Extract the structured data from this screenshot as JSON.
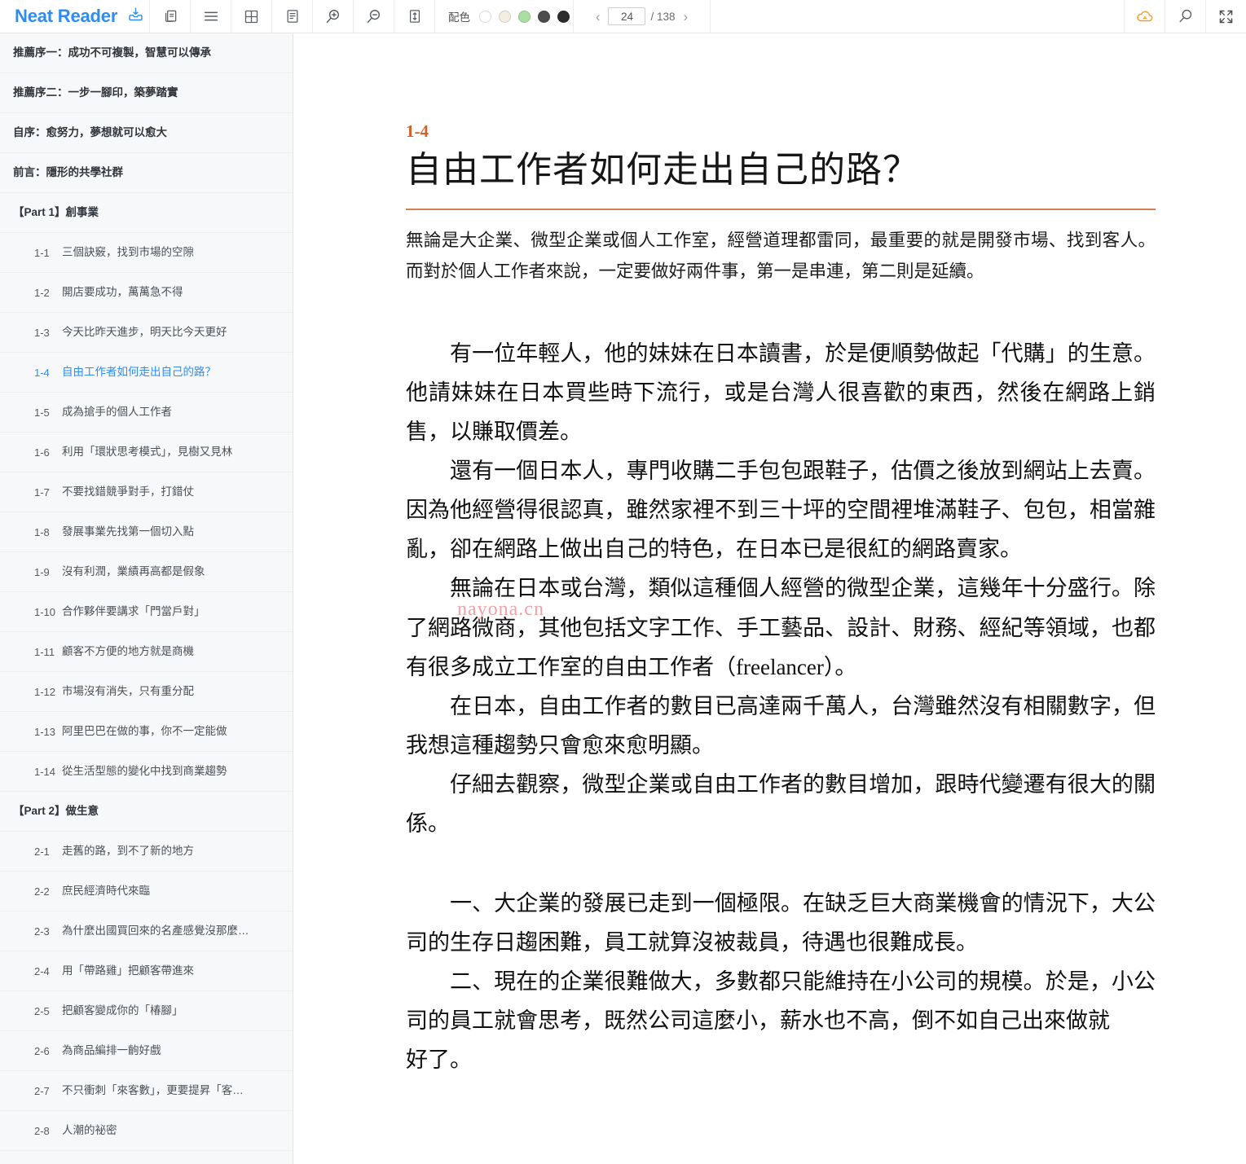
{
  "toolbar": {
    "brand": "Neat Reader",
    "icons": [
      {
        "name": "import-icon",
        "label": "Import"
      },
      {
        "name": "bookshelf-icon",
        "label": "Bookshelf"
      },
      {
        "name": "contents-icon",
        "label": "Contents"
      },
      {
        "name": "grid-view-icon",
        "label": "Grid view"
      },
      {
        "name": "notes-icon",
        "label": "Notes"
      },
      {
        "name": "zoom-in-icon",
        "label": "Zoom in"
      },
      {
        "name": "zoom-out-icon",
        "label": "Zoom out"
      },
      {
        "name": "line-height-icon",
        "label": "Line height"
      }
    ],
    "palette": {
      "label": "配色",
      "swatches": [
        "#ffffff",
        "#f2efe2",
        "#aadfa4",
        "#4c4c4c",
        "#2c2c2c"
      ],
      "selected_index": 0
    },
    "pager": {
      "prev": "‹",
      "next": "›",
      "current": "24",
      "total": "/ 138"
    },
    "right_icons": [
      {
        "name": "cloud-sync-icon",
        "label": "Cloud sync",
        "color": "#f0a030"
      },
      {
        "name": "search-icon",
        "label": "Search"
      },
      {
        "name": "fullscreen-icon",
        "label": "Fullscreen"
      }
    ]
  },
  "sidebar": {
    "items": [
      {
        "type": "front",
        "label": "推薦序一：成功不可複製，智慧可以傳承"
      },
      {
        "type": "front",
        "label": "推薦序二：一步一腳印，築夢踏實"
      },
      {
        "type": "front",
        "label": "自序：愈努力，夢想就可以愈大"
      },
      {
        "type": "front",
        "label": "前言：隱形的共學社群"
      },
      {
        "type": "part",
        "label": "【Part 1】創事業"
      },
      {
        "type": "chapter",
        "num": "1-1",
        "label": "三個訣竅，找到市場的空隙"
      },
      {
        "type": "chapter",
        "num": "1-2",
        "label": "開店要成功，萬萬急不得"
      },
      {
        "type": "chapter",
        "num": "1-3",
        "label": "今天比昨天進步，明天比今天更好"
      },
      {
        "type": "chapter",
        "num": "1-4",
        "label": "自由工作者如何走出自己的路？",
        "active": true
      },
      {
        "type": "chapter",
        "num": "1-5",
        "label": "成為搶手的個人工作者"
      },
      {
        "type": "chapter",
        "num": "1-6",
        "label": "利用「環狀思考模式」，見樹又見林"
      },
      {
        "type": "chapter",
        "num": "1-7",
        "label": "不要找錯競爭對手，打錯仗"
      },
      {
        "type": "chapter",
        "num": "1-8",
        "label": "發展事業先找第一個切入點"
      },
      {
        "type": "chapter",
        "num": "1-9",
        "label": "沒有利潤，業績再高都是假象"
      },
      {
        "type": "chapter",
        "num": "1-10",
        "label": "合作夥伴要講求「門當戶對」"
      },
      {
        "type": "chapter",
        "num": "1-11",
        "label": "顧客不方便的地方就是商機"
      },
      {
        "type": "chapter",
        "num": "1-12",
        "label": "市場沒有消失，只有重分配"
      },
      {
        "type": "chapter",
        "num": "1-13",
        "label": "阿里巴巴在做的事，你不一定能做"
      },
      {
        "type": "chapter",
        "num": "1-14",
        "label": "從生活型態的變化中找到商業趨勢"
      },
      {
        "type": "part",
        "label": "【Part 2】做生意"
      },
      {
        "type": "chapter",
        "num": "2-1",
        "label": "走舊的路，到不了新的地方"
      },
      {
        "type": "chapter",
        "num": "2-2",
        "label": "庶民經濟時代來臨"
      },
      {
        "type": "chapter",
        "num": "2-3",
        "label": "為什麼出國買回來的名產感覺沒那麼…"
      },
      {
        "type": "chapter",
        "num": "2-4",
        "label": "用「帶路雞」把顧客帶進來"
      },
      {
        "type": "chapter",
        "num": "2-5",
        "label": "把顧客變成你的「椿腳」"
      },
      {
        "type": "chapter",
        "num": "2-6",
        "label": "為商品編排一齣好戲"
      },
      {
        "type": "chapter",
        "num": "2-7",
        "label": "不只衝刺「來客數」，更要提昇「客…"
      },
      {
        "type": "chapter",
        "num": "2-8",
        "label": "人潮的祕密"
      }
    ]
  },
  "document": {
    "chapter_number": "1-4",
    "title": "自由工作者如何走出自己的路？",
    "lede": "無論是大企業、微型企業或個人工作室，經營道理都雷同，最重要的就是開發市場、找到客人。而對於個人工作者來說，一定要做好兩件事，第一是串連，第二則是延續。",
    "paragraphs_1": [
      "有一位年輕人，他的妹妹在日本讀書，於是便順勢做起「代購」的生意。他請妹妹在日本買些時下流行，或是台灣人很喜歡的東西，然後在網路上銷售，以賺取價差。",
      "還有一個日本人，專門收購二手包包跟鞋子，估價之後放到網站上去賣。因為他經營得很認真，雖然家裡不到三十坪的空間裡堆滿鞋子、包包，相當雜亂，卻在網路上做出自己的特色，在日本已是很紅的網路賣家。",
      "無論在日本或台灣，類似這種個人經營的微型企業，這幾年十分盛行。除了網路微商，其他包括文字工作、手工藝品、設計、財務、經紀等領域，也都有很多成立工作室的自由工作者（freelancer）。",
      "在日本，自由工作者的數目已高達兩千萬人，台灣雖然沒有相關數字，但我想這種趨勢只會愈來愈明顯。",
      "仔細去觀察，微型企業或自由工作者的數目增加，跟時代變遷有很大的關係。"
    ],
    "paragraphs_2": [
      "一、大企業的發展已走到一個極限。在缺乏巨大商業機會的情況下，大公司的生存日趨困難，員工就算沒被裁員，待遇也很難成長。",
      "二、現在的企業很難做大，多數都只能維持在小公司的規模。於是，小公司的員工就會思考，既然公司這麼小，薪水也不高，倒不如自己出來做就"
    ],
    "paragraph_tail": "好了。",
    "watermark": "nayona.cn"
  }
}
